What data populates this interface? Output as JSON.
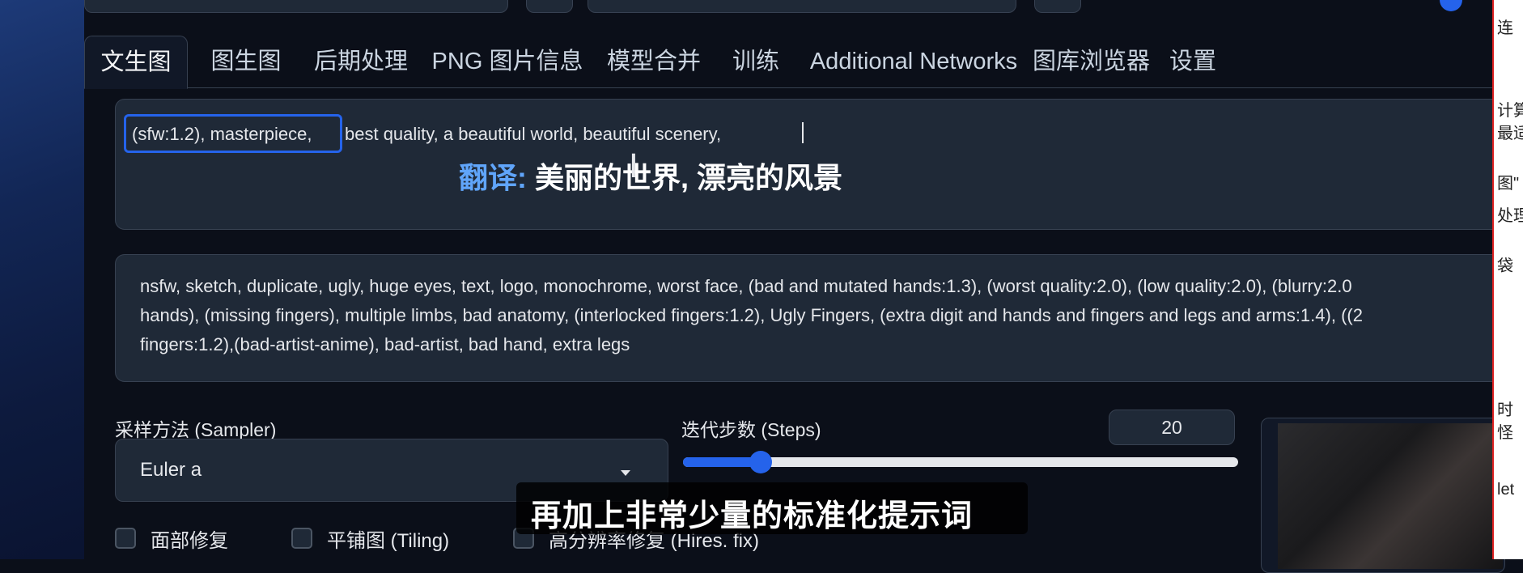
{
  "tabs": [
    {
      "label": "文生图",
      "active": true
    },
    {
      "label": "图生图"
    },
    {
      "label": "后期处理"
    },
    {
      "label": "PNG 图片信息"
    },
    {
      "label": "模型合并"
    },
    {
      "label": "训练"
    },
    {
      "label": "Additional Networks"
    },
    {
      "label": "图库浏览器"
    },
    {
      "label": "设置"
    }
  ],
  "prompt": {
    "highlighted": "(sfw:1.2), masterpiece,",
    "rest": "best quality, a beautiful world, beautiful scenery,"
  },
  "translation_overlay": {
    "label": "翻译:",
    "value": "美丽的世界, 漂亮的风景"
  },
  "negative_prompt": {
    "lines": [
      "nsfw, sketch, duplicate, ugly, huge eyes, text, logo, monochrome, worst face, (bad and mutated hands:1.3), (worst quality:2.0), (low quality:2.0), (blurry:2.0",
      "hands), (missing fingers), multiple limbs, bad anatomy, (interlocked fingers:1.2), Ugly Fingers, (extra digit and hands and fingers and legs and arms:1.4), ((2",
      "fingers:1.2),(bad-artist-anime), bad-artist, bad hand, extra legs"
    ]
  },
  "sampler": {
    "label": "采样方法 (Sampler)",
    "value": "Euler a"
  },
  "steps": {
    "label": "迭代步数 (Steps)",
    "value": "20",
    "level": 0.2
  },
  "checkboxes": [
    {
      "label": "面部修复"
    },
    {
      "label": "平铺图 (Tiling)"
    },
    {
      "label": "高分辨率修复 (Hires. fix)"
    }
  ],
  "subtitle": "再加上非常少量的标准化提示词",
  "right_sliver_texts": [
    "连",
    "计算",
    "最适",
    "图\"",
    "处理",
    "袋",
    "时",
    "怪",
    "let"
  ],
  "colors": {
    "accent": "#2563eb",
    "background": "#0b0f19",
    "field": "#1f2937"
  }
}
